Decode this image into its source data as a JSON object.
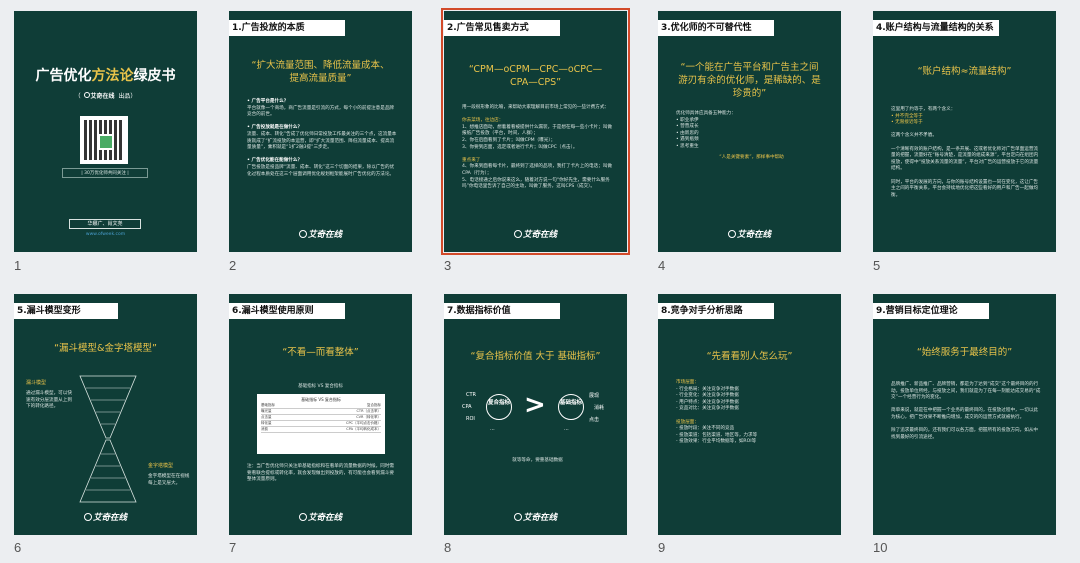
{
  "slides": [
    {
      "num": "1",
      "cover": {
        "title_a": "广告优化",
        "title_b": "方法论",
        "title_c": "绿皮书",
        "sub_open": "（",
        "sub_brand": "艾奇在线",
        "sub_close": "出品）",
        "qr_caption": "| 30万优化师共同关注 |",
        "author": "华娜广、肖文尧",
        "link": "www.ofweek.com"
      }
    },
    {
      "num": "2",
      "title": "1.广告投放的本质",
      "headline": "“扩大流量范围、降低流量成本、提高流量质量”",
      "p1": "• 广告平台是什么？",
      "p2": "平台就像一个商场，商广告流量是引流的方式，每个小的前提注意是品牌竞合的前世。",
      "p3": "• 广告投放就是在做什么？",
      "p4": "流量、成本、转化”告成了优化师日常投放工作最关注的三个点，这流量本质就成了“扩流投放的本运营，即“扩大流量范围、降低流量成本、提高流量质量”，乘积就是“1扩2融3提”三步走。",
      "p5": "• 广告优化能在能做什么？",
      "p6": "广告投放是投品牌“流量、成本、转化”这三个切面的结果，除以广告的优化过程本质处在这三个层面调用优化规划框架能展时广告优化的方法论。"
    },
    {
      "num": "3",
      "title": "2.广告常见售卖方式",
      "headline": "“CPM—oCPM—CPC—oCPC—CPA—CPS”",
      "p1": "用一段很形象的比喻，来帮助大家理解目前市场上常见的一些计费方式：",
      "p2": "你去菜场，往边店：",
      "p3": "1、想推店面动，想着着看被提供什么漏装，于是想在每一些小卡片；叫做报纸广告投放（平台，时间，人群）；",
      "p4": "2、你在后面看到了卡片；叫做CPM（曝光）；",
      "p5": "3、你要到店面，选定或者进行卡片；叫做CPC（点击）。",
      "p6": "重点来了",
      "p7": "4、你来到面看每卡片，最终到了选择的品项，我打了卡片上的电话；叫做CPA（行为）；",
      "p8": "5、电话接通之后你说来这么，随着对方说一句“你好先生，需要什么服务吗”你电话里告诉了自己的主动，叫做了服务，这叫CPS（成交）。"
    },
    {
      "num": "4",
      "title": "3.优化师的不可替代性",
      "headline": "“一个能在广告平台和广告主之间游刃有余的优化师，是稀缺的、是珍贵的”",
      "p1": "优化师具体应具备五种能力：",
      "p2": "• 职业承伊",
      "p3": "• 营营成长",
      "p4": "• 由新思的",
      "p5": "• 遇到瓶颈",
      "p6": "• 思考重生",
      "quote": "“人是关键要素”，那样事中帮助"
    },
    {
      "num": "5",
      "title": "4.账户结构与流量结构的关系",
      "headline": "“账户结构≈流量结构”",
      "p1": "这里用了约等于，有两个含义：",
      "p2": "• 并不完全等于",
      "p3": "• 无限接近等于",
      "p4": "这两个含义并不矛盾。",
      "p5": "一个清晰有效的账户结构，是一条开展、这或者优化师对广告单面运营流量的把握，流量好在“账号清楚，是流量的组成来源”，平台定向在组团内投放，使得中“投放关系流量的流量”，平台对广告的运营投放于它的流量结构。",
      "p6": "同时，平台的发展的方向，与你的账号结构设置也一同在变化，这让广告主之间的平衡关系，平台会持续地优化把这些看好的用户和广告一起做均衡。"
    },
    {
      "num": "6",
      "title": "5.漏斗模型变形",
      "headline": "“漏斗模型&金字塔模型”",
      "lbl1": "漏斗模型",
      "p1": "通过漏斗模型，可以快速有效分层流量从上到下的转化路径。",
      "lbl2": "金字塔模型",
      "p2": "金字塔模型在在视线每上是叉层大。"
    },
    {
      "num": "7",
      "title": "6.漏斗模型使用原则",
      "headline": "“不看—而看整体”",
      "table_caption": "基础指标 VS 复合指标",
      "table_head": "基础指标 VS 复合指标",
      "rows": [
        [
          "基础指标",
          "复合指标"
        ],
        [
          "曝光量",
          "CTR（点击率）"
        ],
        [
          "点击量",
          "CVR（转化率）"
        ],
        [
          "转化量",
          "CPC（平均点击价格）"
        ],
        [
          "消费",
          "CPA（平均转化成本）"
        ]
      ],
      "p1": "注：当广告优化师只关注单基础指标和在看单的流量数据的时候，同时需要看联合提标或转化率，就会发现做出到投放的，有可能也会看到漏斗要整体流量原则。"
    },
    {
      "num": "8",
      "title": "7.数据指标价值",
      "headline": "“复合指标价值 大于 基础指标”",
      "left_tags": [
        "CTR",
        "CPA",
        "ROI"
      ],
      "left_circle": "复合指标",
      "right_circle": "基础指标",
      "right_tags": [
        "展现",
        "消耗",
        "点击"
      ],
      "gt": ">",
      "ellipsis": "...",
      "footer": "就等等命，要重基础数据"
    },
    {
      "num": "9",
      "title": "8.竞争对手分析思路",
      "headline": "“先看看别人怎么玩”",
      "s1": "市场层面：",
      "items1": [
        "- 行业格局：关注竞争对手数据",
        "- 行业变化：关注竞争对手数据",
        "- 用户特点：关注竞争对手数据",
        "- 竞品对比：关注竞争对手数据"
      ],
      "s2": "投放层面：",
      "items2": [
        "- 投放时段：关注不同的竞品",
        "- 投放渠道：包括渠道、地区等，力求等",
        "- 投放效果：行业平均数据等，如ROI等"
      ]
    },
    {
      "num": "10",
      "title": "9.营销目标定位理论",
      "headline": "“始终服务于最终目的”",
      "p1": "品牌推广、新品推广、品牌营销，都是为了达到“成交”这个最终目的的行动，投放单位所经，与投放之间，我们就是为了在每一刻能达成交易的“成交”一个经营行为的变化。",
      "p2": "简单来说，就是在中把握一个业务的最终目的，在投放过程中，一切以此为核心，把广告效果不断推向增加，成交的的运营方式就被执行。",
      "p3": "除了追求最终目的，还有我们可以各方面，把握所有的投放方向，如从中找到最好的引流途径。"
    }
  ]
}
